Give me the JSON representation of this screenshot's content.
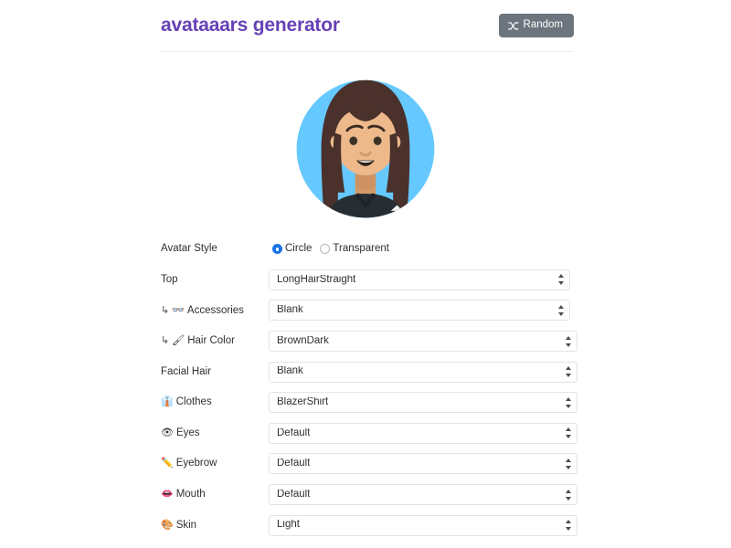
{
  "header": {
    "title": "avataaars generator",
    "random_button": {
      "label": "Random",
      "icon": "shuffle-icon"
    }
  },
  "avatar": {
    "style": "Circle",
    "background_color": "#65C9FF",
    "skin_color": "#EDB98A",
    "hair_color": "#4A312C",
    "clothes_color": "#262E33",
    "top": "LongHairStraight",
    "clothes": "BlazerShirt"
  },
  "form": {
    "rows": [
      {
        "label": "Avatar Style",
        "icon": "",
        "sub": false,
        "control": "radio",
        "options": [
          "Circle",
          "Transparent"
        ],
        "value": "Circle"
      },
      {
        "label": "Top",
        "icon": "",
        "sub": false,
        "control": "select",
        "value": "LongHairStraight"
      },
      {
        "label": "Accessories",
        "icon": "👓",
        "icon_name": "glasses-icon",
        "sub": true,
        "control": "select",
        "value": "Blank"
      },
      {
        "label": "Hair Color",
        "icon": "🖌",
        "icon_name": "hairbrush-icon",
        "sub": true,
        "control": "select",
        "value": "BrownDark"
      },
      {
        "label": "Facial Hair",
        "icon": "",
        "sub": false,
        "control": "select",
        "value": "Blank"
      },
      {
        "label": "Clothes",
        "icon": "👔",
        "icon_name": "necktie-icon",
        "sub": false,
        "control": "select",
        "value": "BlazerShirt"
      },
      {
        "label": "Eyes",
        "icon": "👁",
        "icon_name": "eye-icon",
        "sub": false,
        "control": "select",
        "value": "Default"
      },
      {
        "label": "Eyebrow",
        "icon": "✏️",
        "icon_name": "pencil-icon",
        "sub": false,
        "control": "select",
        "value": "Default"
      },
      {
        "label": "Mouth",
        "icon": "👄",
        "icon_name": "lips-icon",
        "sub": false,
        "control": "select",
        "value": "Default"
      },
      {
        "label": "Skin",
        "icon": "🎨",
        "icon_name": "palette-icon",
        "sub": false,
        "control": "select",
        "value": "Light"
      }
    ],
    "sub_arrow": "↳",
    "select_widths": [
      0,
      330,
      330,
      338,
      338,
      338,
      338,
      338,
      338,
      338
    ]
  },
  "colors": {
    "brand_purple": "#6741b5",
    "button_gray": "#6c757d",
    "radio_blue": "#1a73e8",
    "text": "#2f3033"
  }
}
